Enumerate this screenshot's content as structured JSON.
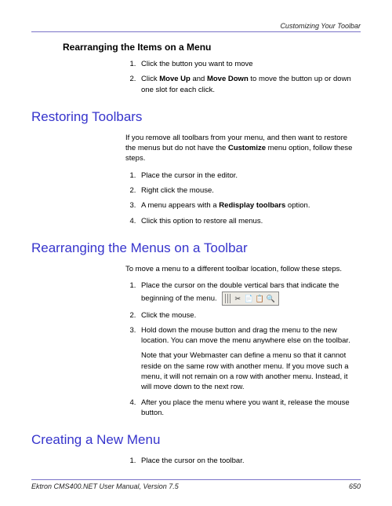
{
  "header": {
    "section_title": "Customizing Your Toolbar"
  },
  "sec_rearranging_items": {
    "heading": "Rearranging the Items on a Menu",
    "steps": {
      "s1": "Click the button you want to move",
      "s2_pre": "Click ",
      "s2_b1": "Move Up",
      "s2_mid": " and ",
      "s2_b2": "Move Down",
      "s2_post": " to move the button up or down one slot for each click."
    }
  },
  "sec_restoring": {
    "heading": "Restoring Toolbars",
    "intro_pre": "If you remove all toolbars from your menu, and then want to restore the menus but do not have the ",
    "intro_b": "Customize",
    "intro_post": " menu option, follow these steps.",
    "steps": {
      "s1": "Place the cursor in the editor.",
      "s2": "Right click the mouse.",
      "s3_pre": "A menu appears with a ",
      "s3_b": "Redisplay toolbars",
      "s3_post": " option.",
      "s4": "Click this option to restore all menus."
    }
  },
  "sec_rearranging_menus": {
    "heading": "Rearranging the Menus on a Toolbar",
    "intro": "To move a menu to a different toolbar location, follow these steps.",
    "steps": {
      "s1_pre": "Place the cursor on the double vertical bars that indicate the beginning of the menu.",
      "s2": "Click the mouse.",
      "s3": "Hold down the mouse button and drag the menu to the new location. You can move the menu anywhere else on the toolbar.",
      "s3_note": "Note that your Webmaster can define a menu so that it cannot reside on the same row with another menu. If you move such a menu, it will not remain on a row with another menu. Instead, it will move down to the next row.",
      "s4": "After you place the menu where you want it, release the mouse button."
    }
  },
  "sec_creating": {
    "heading": "Creating a New Menu",
    "steps": {
      "s1": "Place the cursor on the toolbar."
    }
  },
  "footer": {
    "manual": "Ektron CMS400.NET User Manual, Version 7.5",
    "page": "650"
  }
}
